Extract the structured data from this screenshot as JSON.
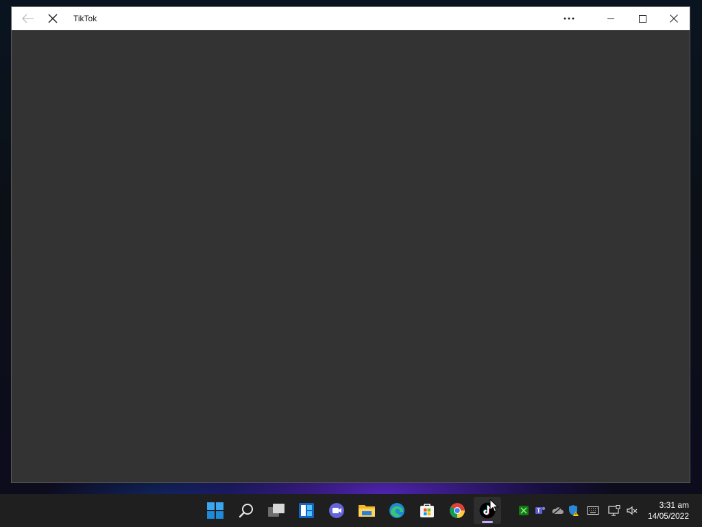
{
  "window": {
    "title": "TikTok"
  },
  "taskbar": {
    "pinned": [
      {
        "name": "start-button",
        "icon": "windows-logo-icon"
      },
      {
        "name": "search-button",
        "icon": "search-icon"
      },
      {
        "name": "task-view-button",
        "icon": "task-view-icon"
      },
      {
        "name": "widgets-button",
        "icon": "widgets-icon"
      },
      {
        "name": "teams-chat-button",
        "icon": "teams-chat-icon"
      },
      {
        "name": "file-explorer-button",
        "icon": "folder-icon"
      },
      {
        "name": "edge-button",
        "icon": "edge-icon"
      },
      {
        "name": "store-button",
        "icon": "store-icon"
      },
      {
        "name": "chrome-button",
        "icon": "chrome-icon"
      },
      {
        "name": "tiktok-button",
        "icon": "tiktok-icon",
        "active": true
      }
    ],
    "tray": [
      "xbox-icon",
      "teams-icon",
      "onedrive-icon",
      "windows-security-icon",
      "keyboard-icon",
      "network-icon",
      "volume-muted-icon"
    ]
  },
  "clock": {
    "time": "3:31 am",
    "date": "14/05/2022"
  },
  "colors": {
    "window_content": "#333333",
    "titlebar": "#ffffff",
    "taskbar": "#1f1f1f",
    "active_indicator": "#c9a7ff"
  }
}
